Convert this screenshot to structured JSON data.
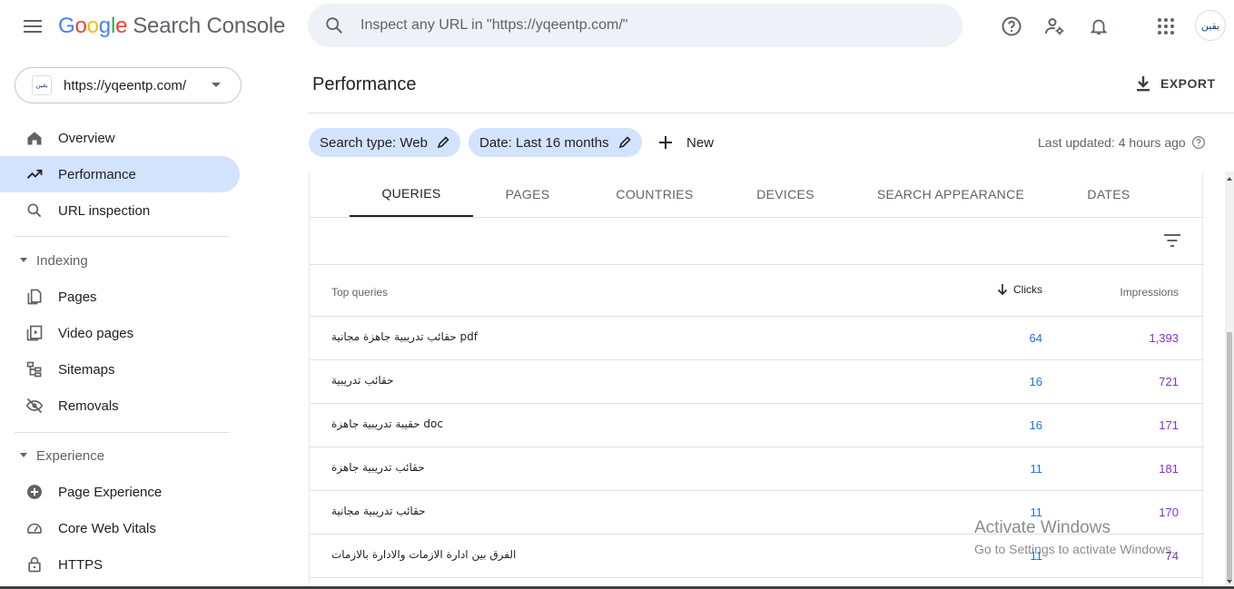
{
  "header": {
    "logo_google": [
      "G",
      "o",
      "o",
      "g",
      "l",
      "e"
    ],
    "logo_product": "Search Console",
    "search_placeholder": "Inspect any URL in \"https://yqeentp.com/\"",
    "avatar_text": "يقين"
  },
  "sidebar": {
    "property_url": "https://yqeentp.com/",
    "property_logo_text": "يقين",
    "items_top": [
      {
        "label": "Overview",
        "icon": "home-icon"
      },
      {
        "label": "Performance",
        "icon": "trending-up-icon",
        "active": true
      },
      {
        "label": "URL inspection",
        "icon": "search-icon"
      }
    ],
    "indexing": {
      "title": "Indexing",
      "items": [
        {
          "label": "Pages",
          "icon": "pages-icon"
        },
        {
          "label": "Video pages",
          "icon": "video-pages-icon"
        },
        {
          "label": "Sitemaps",
          "icon": "sitemap-icon"
        },
        {
          "label": "Removals",
          "icon": "removals-icon"
        }
      ]
    },
    "experience": {
      "title": "Experience",
      "items": [
        {
          "label": "Page Experience",
          "icon": "page-experience-icon"
        },
        {
          "label": "Core Web Vitals",
          "icon": "gauge-icon"
        },
        {
          "label": "HTTPS",
          "icon": "lock-icon"
        }
      ]
    }
  },
  "main": {
    "title": "Performance",
    "export_label": "EXPORT",
    "chips": {
      "search_type": "Search type: Web",
      "date": "Date: Last 16 months",
      "new_label": "New"
    },
    "last_updated": "Last updated: 4 hours ago",
    "tabs": [
      "QUERIES",
      "PAGES",
      "COUNTRIES",
      "DEVICES",
      "SEARCH APPEARANCE",
      "DATES"
    ],
    "active_tab": "QUERIES",
    "table": {
      "columns": {
        "query": "Top queries",
        "clicks": "Clicks",
        "impressions": "Impressions"
      },
      "sort": "clicks-descending",
      "rows": [
        {
          "query": "حقائب تدريبية جاهزة مجانية pdf",
          "clicks": "64",
          "impressions": "1,393"
        },
        {
          "query": "حقائب تدريبية",
          "clicks": "16",
          "impressions": "721"
        },
        {
          "query": "حقيبة تدريبية جاهزة doc",
          "clicks": "16",
          "impressions": "171"
        },
        {
          "query": "حقائب تدريبية جاهزة",
          "clicks": "11",
          "impressions": "181"
        },
        {
          "query": "حقائب تدريبية مجانية",
          "clicks": "11",
          "impressions": "170"
        },
        {
          "query": "الفرق بين ادارة الازمات والادارة بالازمات",
          "clicks": "11",
          "impressions": "74"
        }
      ]
    }
  },
  "watermark": {
    "line1": "Activate Windows",
    "line2": "Go to Settings to activate Windows."
  },
  "colors": {
    "active_nav": "#d3e3fd",
    "chip_bg": "#d3e3fd",
    "clicks": "#1a73e8",
    "impressions": "#8430ce",
    "search_bg": "#eef2f8"
  }
}
